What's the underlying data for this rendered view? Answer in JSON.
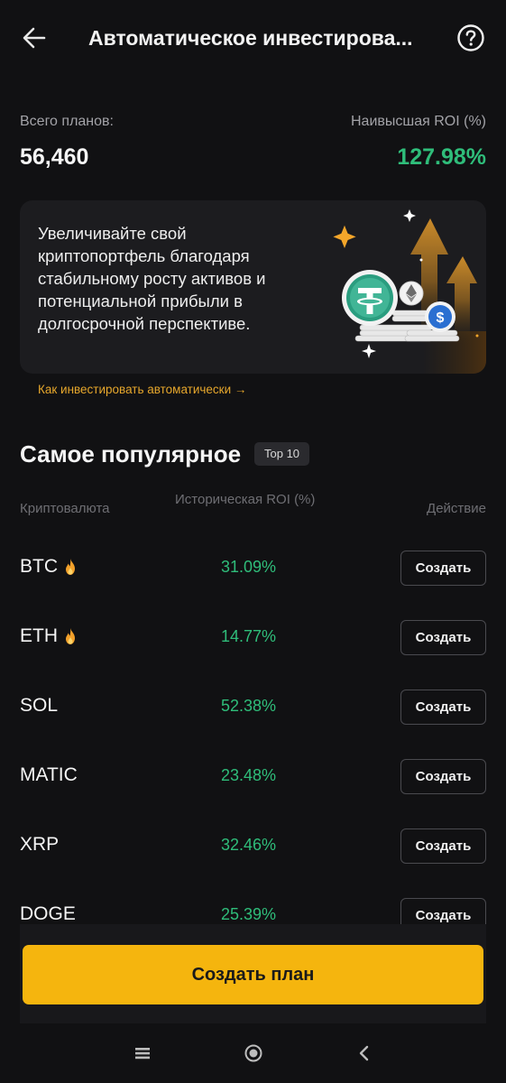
{
  "header": {
    "title": "Автоматическое инвестирова...",
    "back_icon": "arrow-left-icon",
    "help_icon": "question-circle-icon"
  },
  "stats": {
    "total_label": "Всего планов:",
    "total_value": "56,460",
    "roi_label": "Наивысшая ROI (%)",
    "roi_value": "127.98%"
  },
  "banner": {
    "text": "Увеличивайте свой криптопортфель благодаря стабильному росту активов и потенциальной прибыли в долгосрочной перспективе.",
    "link": "Как инвестировать автоматически",
    "link_arrow": "→"
  },
  "popular": {
    "title": "Самое популярное",
    "badge": "Top 10",
    "columns": {
      "crypto": "Криптовалюта",
      "roi": "Историческая ROI (%)",
      "action": "Действие"
    },
    "rows": [
      {
        "coin": "BTC",
        "hot": true,
        "roi": "31.09%",
        "action": "Создать"
      },
      {
        "coin": "ETH",
        "hot": true,
        "roi": "14.77%",
        "action": "Создать"
      },
      {
        "coin": "SOL",
        "hot": false,
        "roi": "52.38%",
        "action": "Создать"
      },
      {
        "coin": "MATIC",
        "hot": false,
        "roi": "23.48%",
        "action": "Создать"
      },
      {
        "coin": "XRP",
        "hot": false,
        "roi": "32.46%",
        "action": "Создать"
      },
      {
        "coin": "DOGE",
        "hot": false,
        "roi": "25.39%",
        "action": "Создать"
      }
    ]
  },
  "footer": {
    "create_plan": "Создать план"
  },
  "navbar": {
    "icons": [
      "menu-lines-icon",
      "home-circle-icon",
      "chevron-back-icon"
    ]
  },
  "colors": {
    "background": "#111113",
    "positive": "#2fbd7a",
    "accent": "#f5b50e",
    "link": "#e6a72c"
  }
}
